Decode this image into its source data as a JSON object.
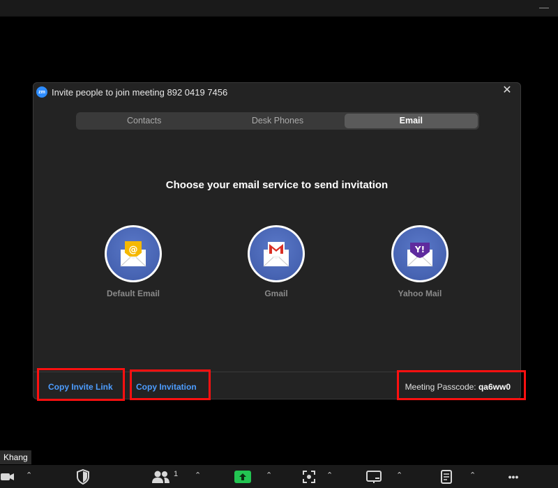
{
  "dialog": {
    "logo_text": "zm",
    "title": "Invite people to join meeting 892 0419 7456",
    "close_glyph": "✕",
    "tabs": [
      {
        "label": "Contacts",
        "active": false
      },
      {
        "label": "Desk Phones",
        "active": false
      },
      {
        "label": "Email",
        "active": true
      }
    ],
    "heading": "Choose your email service to send invitation",
    "services": [
      {
        "label": "Default Email",
        "icon": "default-email-icon"
      },
      {
        "label": "Gmail",
        "icon": "gmail-icon"
      },
      {
        "label": "Yahoo Mail",
        "icon": "yahoo-mail-icon"
      }
    ],
    "footer": {
      "copy_invite_link": "Copy Invite Link",
      "copy_invitation": "Copy Invitation",
      "passcode_label": "Meeting Passcode:",
      "passcode_value": "qa6ww0"
    }
  },
  "participant_name": "Khang",
  "toolbar": {
    "participants_count": "1",
    "more_glyph": "•••"
  },
  "colors": {
    "highlight": "#ff1010",
    "link": "#4d9dff",
    "share_green": "#23c552"
  }
}
